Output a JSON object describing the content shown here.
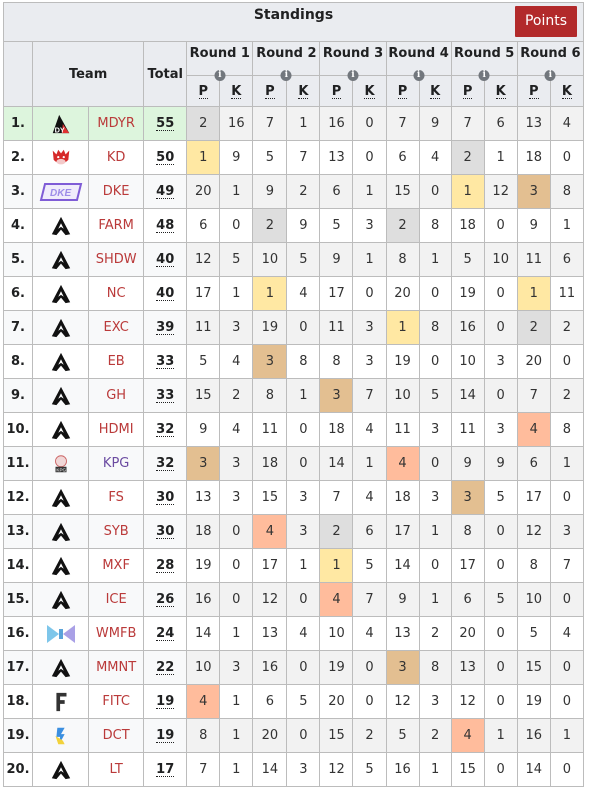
{
  "table": {
    "title": "Standings",
    "points_button": "Points",
    "headers": {
      "team": "Team",
      "total": "Total",
      "rounds": [
        "Round 1",
        "Round 2",
        "Round 3",
        "Round 4",
        "Round 5",
        "Round 6"
      ],
      "placement_abbr": "P",
      "kills_abbr": "K"
    },
    "highlight_colors": {
      "place_1": "#ffe8a3",
      "place_2": "#dedede",
      "place_3": "#e3bf91",
      "place_4": "#ffbc9c",
      "leader_row": "#ddf5dd",
      "team_link": "#ba3a3a",
      "team_link_existing": "#6b4ba1",
      "points_button": "#b22a2b"
    },
    "rows": [
      {
        "rank": "1.",
        "logo": "mdyr-logo",
        "team": "MDYR",
        "total": "55",
        "scores": [
          [
            2,
            16
          ],
          [
            7,
            1
          ],
          [
            16,
            0
          ],
          [
            7,
            9
          ],
          [
            7,
            6
          ],
          [
            13,
            4
          ]
        ]
      },
      {
        "rank": "2.",
        "logo": "kd-dragon-logo",
        "team": "KD",
        "total": "50",
        "scores": [
          [
            1,
            9
          ],
          [
            5,
            7
          ],
          [
            13,
            0
          ],
          [
            6,
            4
          ],
          [
            2,
            1
          ],
          [
            18,
            0
          ]
        ]
      },
      {
        "rank": "3.",
        "logo": "dke-logo",
        "team": "DKE",
        "total": "49",
        "scores": [
          [
            20,
            1
          ],
          [
            9,
            2
          ],
          [
            6,
            1
          ],
          [
            15,
            0
          ],
          [
            1,
            12
          ],
          [
            3,
            8
          ]
        ]
      },
      {
        "rank": "4.",
        "logo": "apex-default-logo",
        "team": "FARM",
        "total": "48",
        "scores": [
          [
            6,
            0
          ],
          [
            2,
            9
          ],
          [
            5,
            3
          ],
          [
            2,
            8
          ],
          [
            18,
            0
          ],
          [
            9,
            1
          ]
        ]
      },
      {
        "rank": "5.",
        "logo": "apex-default-logo",
        "team": "SHDW",
        "total": "40",
        "scores": [
          [
            12,
            5
          ],
          [
            10,
            5
          ],
          [
            9,
            1
          ],
          [
            8,
            1
          ],
          [
            5,
            10
          ],
          [
            11,
            6
          ]
        ]
      },
      {
        "rank": "6.",
        "logo": "apex-default-logo",
        "team": "NC",
        "total": "40",
        "scores": [
          [
            17,
            1
          ],
          [
            1,
            4
          ],
          [
            17,
            0
          ],
          [
            20,
            0
          ],
          [
            19,
            0
          ],
          [
            1,
            11
          ]
        ]
      },
      {
        "rank": "7.",
        "logo": "apex-default-logo",
        "team": "EXC",
        "total": "39",
        "scores": [
          [
            11,
            3
          ],
          [
            19,
            0
          ],
          [
            11,
            3
          ],
          [
            1,
            8
          ],
          [
            16,
            0
          ],
          [
            2,
            2
          ]
        ]
      },
      {
        "rank": "8.",
        "logo": "apex-default-logo",
        "team": "EB",
        "total": "33",
        "scores": [
          [
            5,
            4
          ],
          [
            3,
            8
          ],
          [
            8,
            3
          ],
          [
            19,
            0
          ],
          [
            10,
            3
          ],
          [
            20,
            0
          ]
        ]
      },
      {
        "rank": "9.",
        "logo": "apex-default-logo",
        "team": "GH",
        "total": "33",
        "scores": [
          [
            15,
            2
          ],
          [
            8,
            1
          ],
          [
            3,
            7
          ],
          [
            10,
            5
          ],
          [
            14,
            0
          ],
          [
            7,
            2
          ]
        ]
      },
      {
        "rank": "10.",
        "logo": "apex-default-logo",
        "team": "HDMI",
        "total": "32",
        "scores": [
          [
            9,
            4
          ],
          [
            11,
            0
          ],
          [
            18,
            4
          ],
          [
            11,
            3
          ],
          [
            11,
            3
          ],
          [
            4,
            8
          ]
        ]
      },
      {
        "rank": "11.",
        "logo": "kpg-logo",
        "team": "KPG",
        "total": "32",
        "link_existing": true,
        "scores": [
          [
            3,
            3
          ],
          [
            18,
            0
          ],
          [
            14,
            1
          ],
          [
            4,
            0
          ],
          [
            9,
            9
          ],
          [
            6,
            1
          ]
        ]
      },
      {
        "rank": "12.",
        "logo": "apex-default-logo",
        "team": "FS",
        "total": "30",
        "scores": [
          [
            13,
            3
          ],
          [
            15,
            3
          ],
          [
            7,
            4
          ],
          [
            18,
            3
          ],
          [
            3,
            5
          ],
          [
            17,
            0
          ]
        ]
      },
      {
        "rank": "13.",
        "logo": "apex-default-logo",
        "team": "SYB",
        "total": "30",
        "scores": [
          [
            18,
            0
          ],
          [
            4,
            3
          ],
          [
            2,
            6
          ],
          [
            17,
            1
          ],
          [
            8,
            0
          ],
          [
            12,
            3
          ]
        ]
      },
      {
        "rank": "14.",
        "logo": "apex-default-logo",
        "team": "MXF",
        "total": "28",
        "scores": [
          [
            19,
            0
          ],
          [
            17,
            1
          ],
          [
            1,
            5
          ],
          [
            14,
            0
          ],
          [
            17,
            0
          ],
          [
            8,
            7
          ]
        ]
      },
      {
        "rank": "15.",
        "logo": "apex-default-logo",
        "team": "ICE",
        "total": "26",
        "scores": [
          [
            16,
            0
          ],
          [
            12,
            0
          ],
          [
            4,
            7
          ],
          [
            9,
            1
          ],
          [
            6,
            5
          ],
          [
            10,
            0
          ]
        ]
      },
      {
        "rank": "16.",
        "logo": "wmfb-logo",
        "team": "WMFB",
        "total": "24",
        "scores": [
          [
            14,
            1
          ],
          [
            13,
            4
          ],
          [
            10,
            4
          ],
          [
            13,
            2
          ],
          [
            20,
            0
          ],
          [
            5,
            4
          ]
        ]
      },
      {
        "rank": "17.",
        "logo": "apex-default-logo",
        "team": "MMNT",
        "total": "22",
        "scores": [
          [
            10,
            3
          ],
          [
            16,
            0
          ],
          [
            19,
            0
          ],
          [
            3,
            8
          ],
          [
            13,
            0
          ],
          [
            15,
            0
          ]
        ]
      },
      {
        "rank": "18.",
        "logo": "fitc-logo",
        "team": "FITC",
        "total": "19",
        "scores": [
          [
            4,
            1
          ],
          [
            6,
            5
          ],
          [
            20,
            0
          ],
          [
            12,
            3
          ],
          [
            12,
            0
          ],
          [
            19,
            0
          ]
        ]
      },
      {
        "rank": "19.",
        "logo": "dct-logo",
        "team": "DCT",
        "total": "19",
        "scores": [
          [
            8,
            1
          ],
          [
            20,
            0
          ],
          [
            15,
            2
          ],
          [
            5,
            2
          ],
          [
            4,
            1
          ],
          [
            16,
            1
          ]
        ]
      },
      {
        "rank": "20.",
        "logo": "apex-default-logo",
        "team": "LT",
        "total": "17",
        "scores": [
          [
            7,
            1
          ],
          [
            14,
            3
          ],
          [
            12,
            5
          ],
          [
            16,
            1
          ],
          [
            15,
            0
          ],
          [
            14,
            0
          ]
        ]
      }
    ]
  }
}
